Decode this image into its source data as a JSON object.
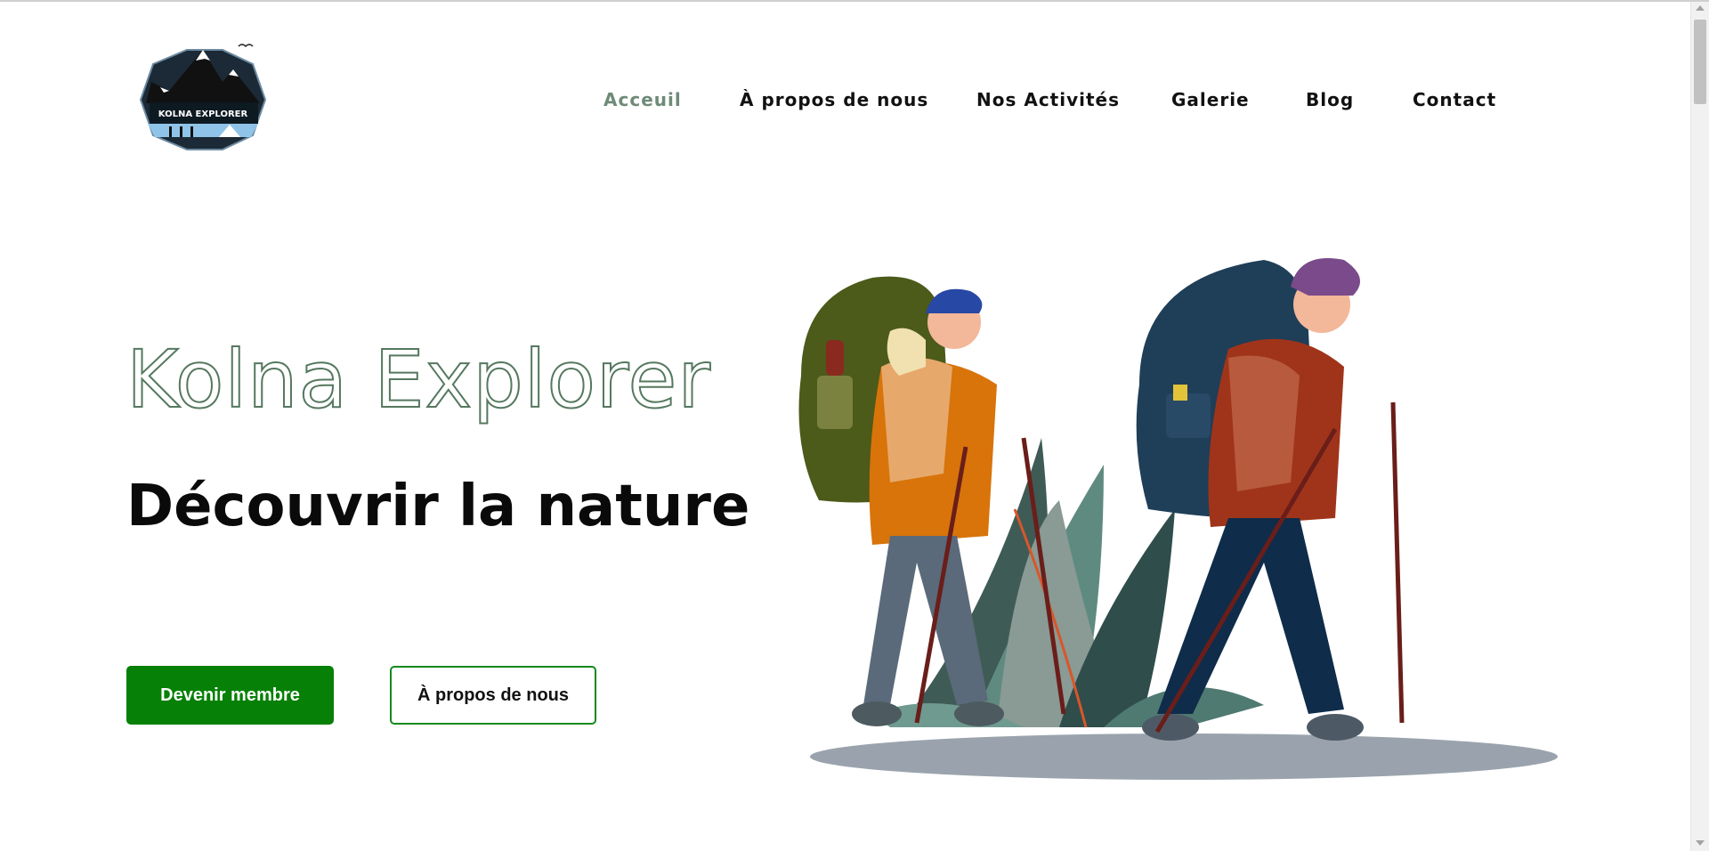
{
  "logo": {
    "text": "KOLNA EXPLORER"
  },
  "nav": {
    "items": [
      {
        "label": "Acceuil",
        "active": true
      },
      {
        "label": "À propos de nous",
        "active": false
      },
      {
        "label": "Nos Activités",
        "active": false
      },
      {
        "label": "Galerie",
        "active": false
      },
      {
        "label": "Blog",
        "active": false
      },
      {
        "label": "Contact",
        "active": false
      }
    ]
  },
  "hero": {
    "title": "Kolna Explorer",
    "subtitle": "Découvrir la nature",
    "primary_button": "Devenir membre",
    "secondary_button": "À propos de nous"
  },
  "colors": {
    "accent_green": "#068006",
    "outline_green": "#55785f",
    "nav_active": "#6e8b78"
  },
  "icons": [
    "logo-mountain-badge",
    "hikers-illustration"
  ]
}
